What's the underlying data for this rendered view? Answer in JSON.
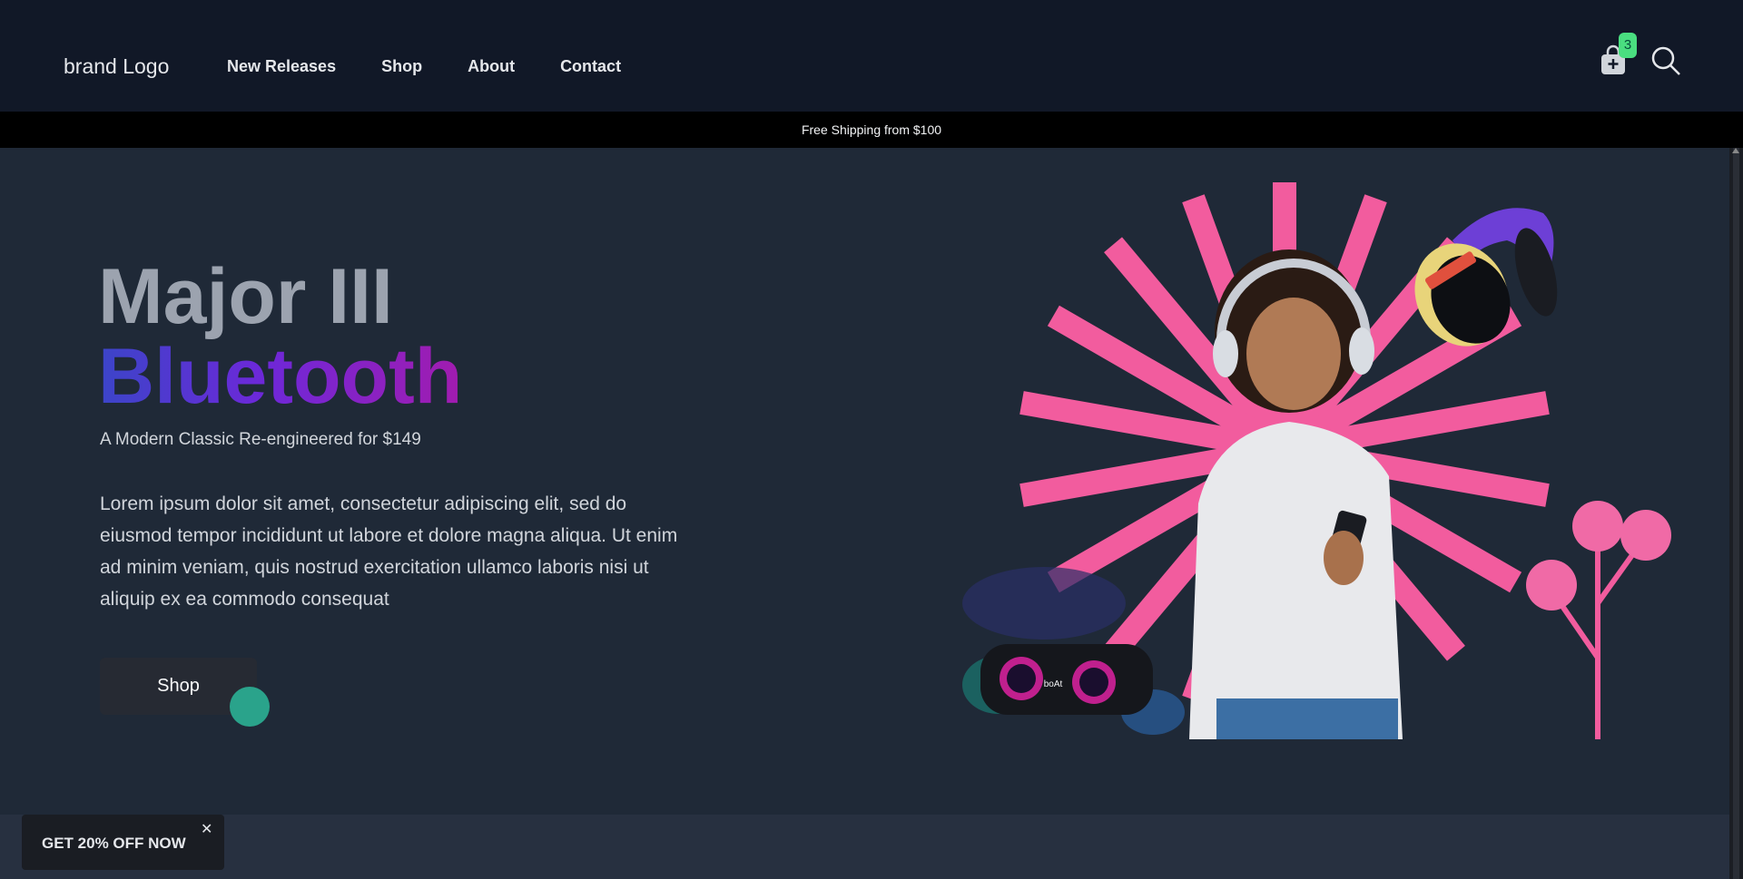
{
  "header": {
    "brand": "brand Logo",
    "nav": [
      "New Releases",
      "Shop",
      "About",
      "Contact"
    ],
    "cart_count": "3",
    "cart_icon": "shopping-bag-icon",
    "search_icon": "search-icon"
  },
  "announcement": "Free Shipping from $100",
  "hero": {
    "title_line1": "Major III",
    "title_line2": "Bluetooth",
    "subtitle": "A Modern Classic Re-engineered for $149",
    "body": "Lorem ipsum dolor sit amet, consectetur adipiscing elit, sed do eiusmod tempor incididunt ut labore et dolore magna aliqua. Ut enim ad minim veniam, quis nostrud exercitation ullamco laboris nisi ut aliquip ex ea commodo consequat",
    "cta": "Shop",
    "speaker_label": "boAt"
  },
  "promo": {
    "label": "GET 20% OFF NOW",
    "close": "✕"
  },
  "colors": {
    "header_bg": "#111827",
    "hero_bg": "#1f2937",
    "accent_pink": "#f25c9e",
    "badge_green": "#4ade80",
    "gradient_start": "#3b45c8",
    "gradient_end": "#a21caf"
  }
}
